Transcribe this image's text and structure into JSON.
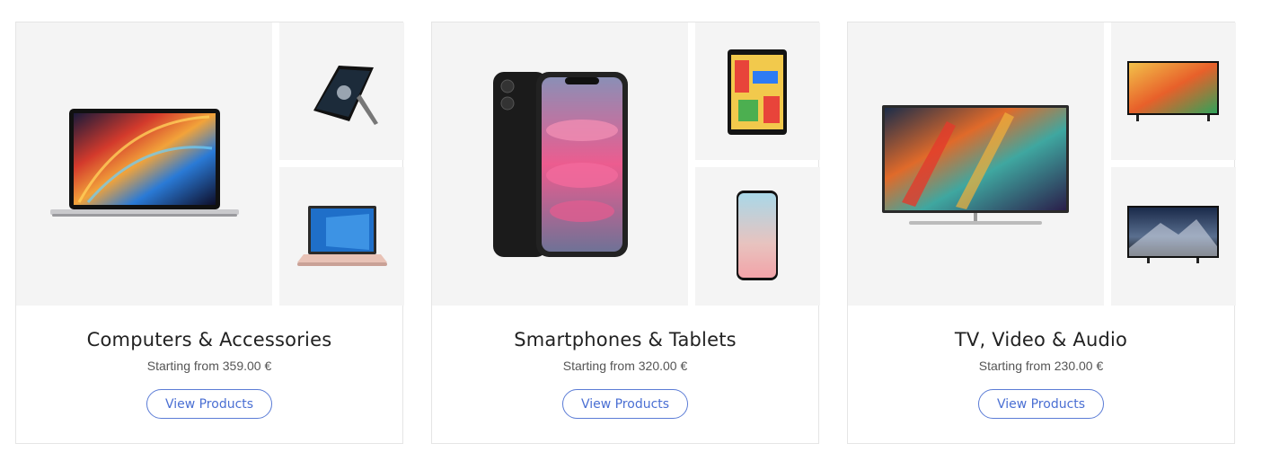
{
  "categories": [
    {
      "title": "Computers & Accessories",
      "price": "Starting from 359.00 €",
      "button": "View Products",
      "images": [
        "laptop-image",
        "tablet-2in1-image",
        "notebook-image"
      ]
    },
    {
      "title": "Smartphones & Tablets",
      "price": "Starting from 320.00 €",
      "button": "View Products",
      "images": [
        "smartphone-image",
        "tablet-image",
        "phone-image"
      ]
    },
    {
      "title": "TV, Video & Audio",
      "price": "Starting from 230.00 €",
      "button": "View Products",
      "images": [
        "qled-tv-image",
        "smart-tv-image",
        "led-tv-image"
      ]
    }
  ],
  "colors": {
    "accent": "#4a6fd3",
    "tile_bg": "#f4f4f4",
    "border": "#e5e5e5"
  }
}
